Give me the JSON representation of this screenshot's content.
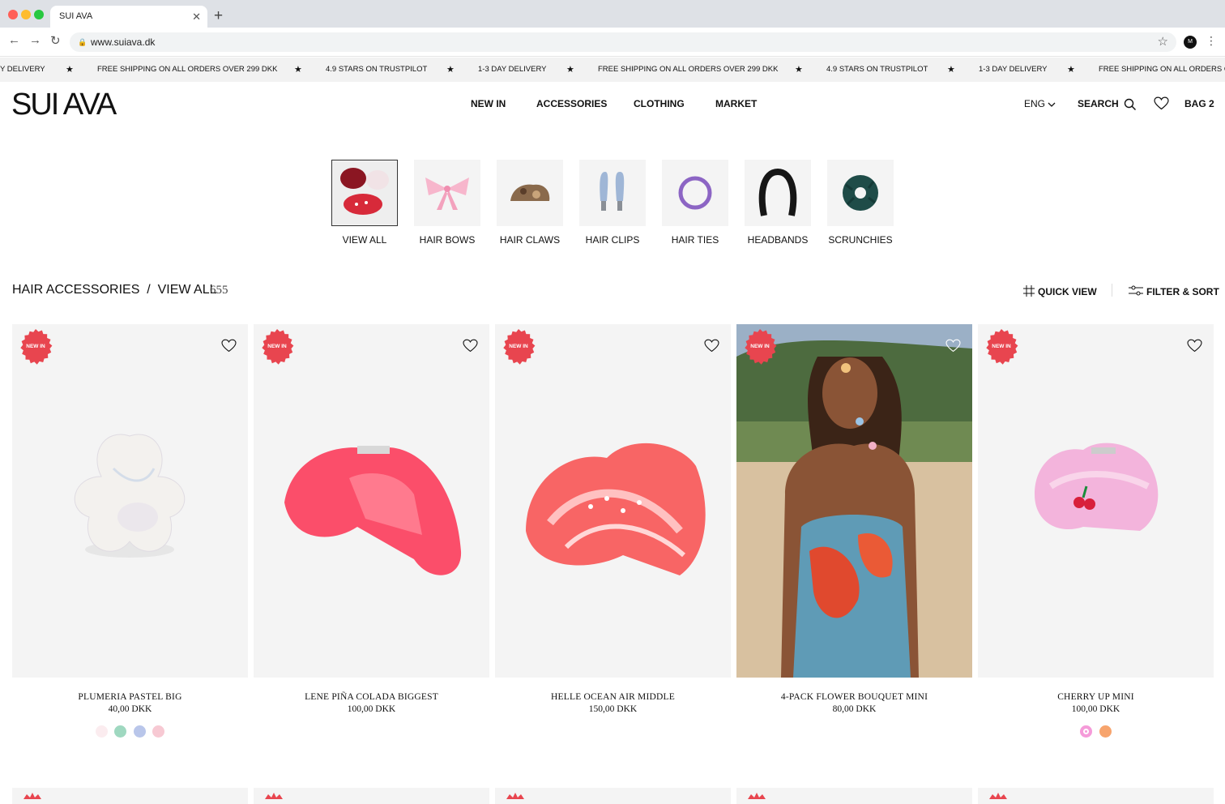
{
  "browser": {
    "tab_title": "SUI AVA",
    "url": "www.suiava.dk",
    "profile_initials": "M"
  },
  "marquee": {
    "items": [
      "Y DELIVERY",
      "FREE SHIPPING ON ALL ORDERS OVER 299 DKK",
      "4.9 STARS ON TRUSTPILOT",
      "1-3 DAY DELIVERY",
      "FREE SHIPPING ON ALL ORDERS OVER 299 DKK",
      "4.9 STARS ON TRUSTPILOT",
      "1-3 DAY DELIVERY",
      "FREE SHIPPING ON ALL ORDERS O"
    ],
    "separator": "★"
  },
  "header": {
    "logo": "SUI AVA",
    "nav": [
      "NEW IN",
      "ACCESSORIES",
      "CLOTHING",
      "MARKET"
    ],
    "language": "ENG",
    "search_label": "SEARCH",
    "bag_label": "BAG 2"
  },
  "categories": [
    {
      "label": "VIEW ALL",
      "icon": "mixed-claws-image",
      "selected": true
    },
    {
      "label": "HAIR BOWS",
      "icon": "pink-bow-image"
    },
    {
      "label": "HAIR CLAWS",
      "icon": "tortoise-claw-image"
    },
    {
      "label": "HAIR CLIPS",
      "icon": "blue-clips-image"
    },
    {
      "label": "HAIR TIES",
      "icon": "purple-tie-image"
    },
    {
      "label": "HEADBANDS",
      "icon": "black-headband-image"
    },
    {
      "label": "SCRUNCHIES",
      "icon": "green-scrunchie-image"
    }
  ],
  "listing": {
    "breadcrumb": "HAIR ACCESSORIES  /  VIEW ALL",
    "count": "655",
    "quick_view": "QUICK VIEW",
    "filter_sort": "FILTER & SORT"
  },
  "products": [
    {
      "badge": "NEW IN",
      "name": "PLUMERIA PASTEL BIG",
      "price": "40,00 DKK",
      "swatches": [
        "#fbecef",
        "#9fd8c0",
        "#b9c6ea",
        "#f7c9d3"
      ]
    },
    {
      "badge": "NEW IN",
      "name": "LENE PIÑA COLADA BIGGEST",
      "price": "100,00 DKK",
      "swatches": []
    },
    {
      "badge": "NEW IN",
      "name": "HELLE OCEAN AIR MIDDLE",
      "price": "150,00 DKK",
      "swatches": []
    },
    {
      "badge": "NEW IN",
      "name": "4-PACK FLOWER BOUQUET MINI",
      "price": "80,00 DKK",
      "swatches": []
    },
    {
      "badge": "NEW IN",
      "name": "CHERRY UP MINI",
      "price": "100,00 DKK",
      "swatches": [
        "#f59bd9",
        "#f7a46d"
      ]
    }
  ],
  "colors": {
    "badge": "#e8454f",
    "marquee_bg": "#f2f2f2",
    "tile_bg": "#f4f4f4"
  }
}
